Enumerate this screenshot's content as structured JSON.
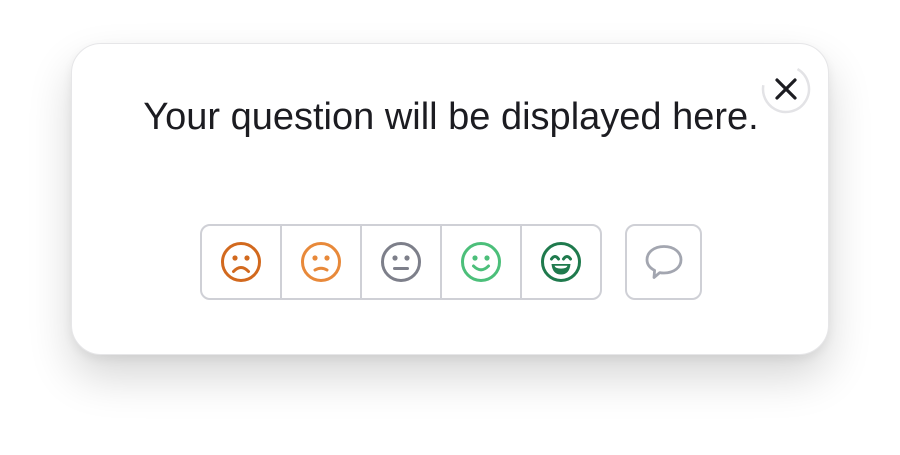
{
  "survey": {
    "question": "Your question will be displayed here.",
    "ratings": [
      {
        "name": "very-dissatisfied",
        "icon": "frown-face-icon",
        "color": "#d2691e"
      },
      {
        "name": "dissatisfied",
        "icon": "sad-face-icon",
        "color": "#e8893a"
      },
      {
        "name": "neutral",
        "icon": "neutral-face-icon",
        "color": "#7d7f8a"
      },
      {
        "name": "satisfied",
        "icon": "smile-face-icon",
        "color": "#4cbf7a"
      },
      {
        "name": "very-satisfied",
        "icon": "grin-face-icon",
        "color": "#1f7a4d"
      }
    ],
    "comment_icon": "speech-bubble-icon",
    "close_icon": "close-icon"
  },
  "colors": {
    "text": "#1c1c21",
    "border": "#cfd0d6",
    "close_ring": "#e3e3e6",
    "comment_icon": "#a3a6b0"
  }
}
